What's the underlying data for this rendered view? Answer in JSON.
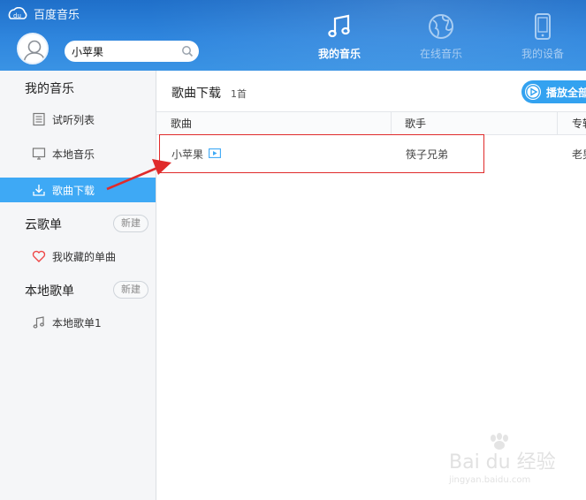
{
  "app": {
    "name": "百度音乐"
  },
  "search": {
    "value": "小苹果"
  },
  "nav": [
    {
      "label": "我的音乐",
      "icon": "music-note-icon",
      "active": true
    },
    {
      "label": "在线音乐",
      "icon": "globe-icon",
      "active": false
    },
    {
      "label": "我的设备",
      "icon": "phone-device-icon",
      "active": false
    }
  ],
  "sidebar": {
    "my_music": {
      "title": "我的音乐",
      "items": [
        {
          "label": "试听列表",
          "icon": "list-icon"
        },
        {
          "label": "本地音乐",
          "icon": "monitor-icon"
        },
        {
          "label": "歌曲下载",
          "icon": "download-icon",
          "selected": true
        }
      ]
    },
    "cloud": {
      "title": "云歌单",
      "new_label": "新建",
      "items": [
        {
          "label": "我收藏的单曲",
          "icon": "heart-icon"
        }
      ]
    },
    "local": {
      "title": "本地歌单",
      "new_label": "新建",
      "items": [
        {
          "label": "本地歌单1",
          "icon": "music-note-icon"
        }
      ]
    }
  },
  "main": {
    "title": "歌曲下载",
    "count": "1首",
    "play_all_label": "播放全部",
    "columns": [
      "歌曲",
      "歌手",
      "专辑"
    ],
    "rows": [
      {
        "song": "小苹果",
        "artist": "筷子兄弟",
        "album": "老男孩",
        "mv_icon": "mv-play-icon"
      }
    ]
  },
  "watermark": {
    "logo": "Bai du 经验",
    "url": "jingyan.baidu.com"
  },
  "colors": {
    "header": "#2f86de",
    "selected": "#3ea9f5",
    "highlight": "#e02b2b",
    "arrow": "#e02b2b"
  }
}
